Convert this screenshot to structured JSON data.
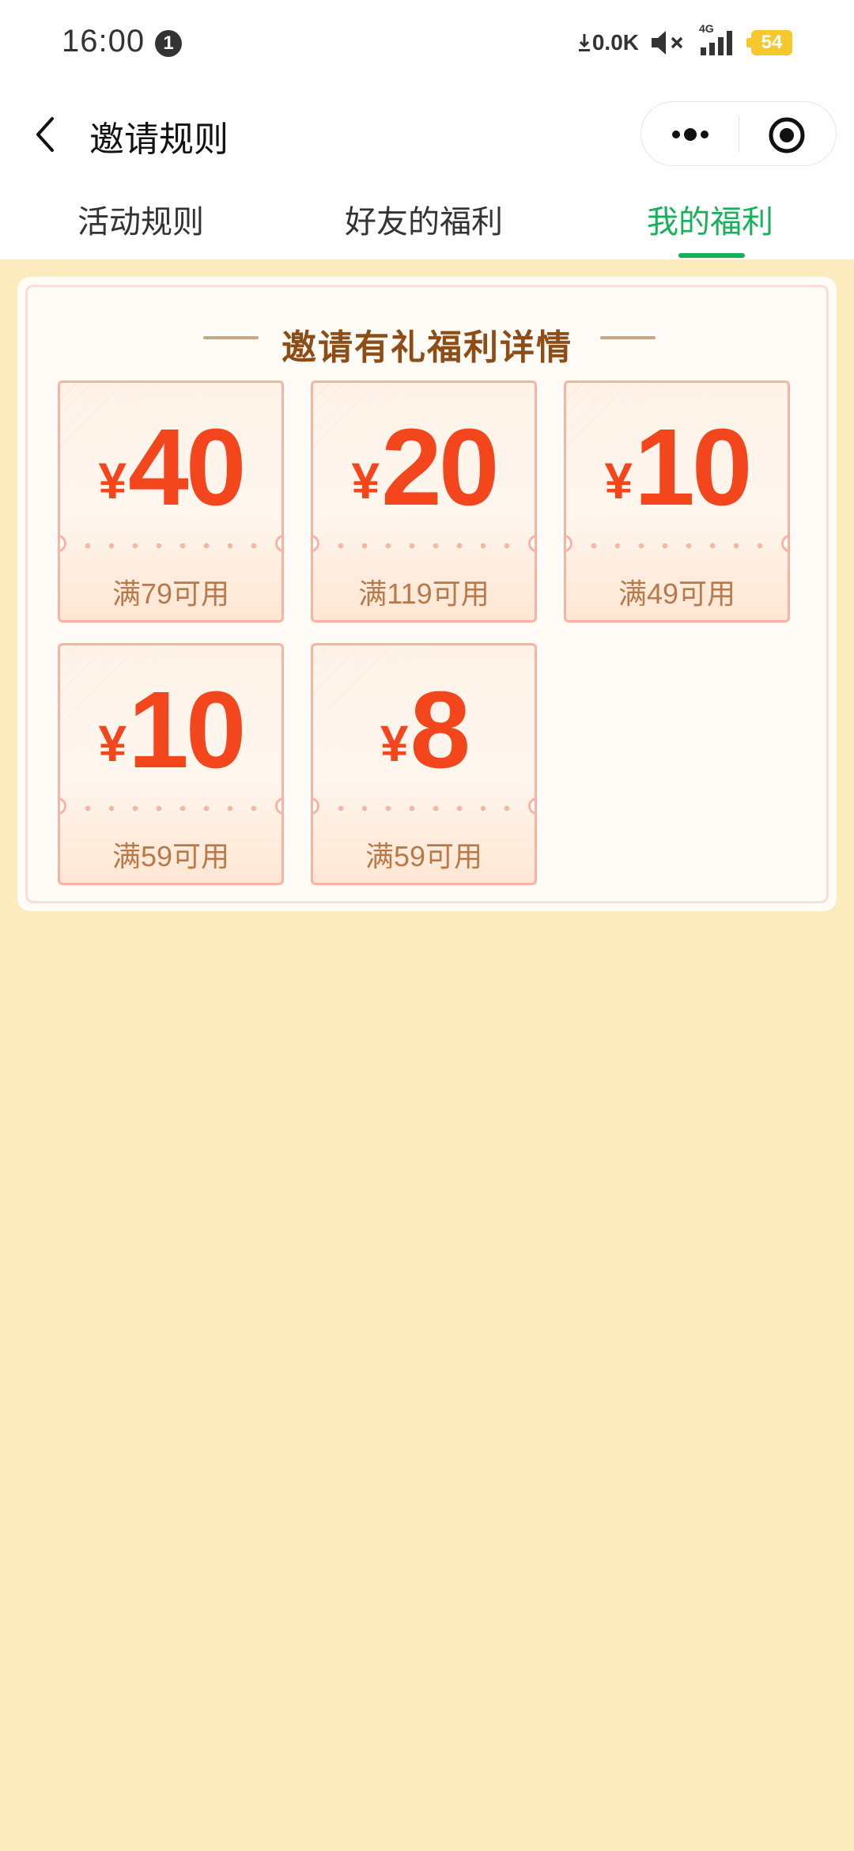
{
  "status_bar": {
    "time": "16:00",
    "notification_count": "1",
    "net_speed": "0.0K",
    "network_type": "4G",
    "battery": "54"
  },
  "nav": {
    "title": "邀请规则"
  },
  "tabs": [
    {
      "label": "活动规则",
      "active": false
    },
    {
      "label": "好友的福利",
      "active": false
    },
    {
      "label": "我的福利",
      "active": true
    }
  ],
  "panel": {
    "title": "邀请有礼福利详情",
    "coupons": [
      {
        "currency": "¥",
        "amount": "40",
        "condition": "满79可用"
      },
      {
        "currency": "¥",
        "amount": "20",
        "condition": "满119可用"
      },
      {
        "currency": "¥",
        "amount": "10",
        "condition": "满49可用"
      },
      {
        "currency": "¥",
        "amount": "10",
        "condition": "满59可用"
      },
      {
        "currency": "¥",
        "amount": "8",
        "condition": "满59可用"
      }
    ]
  },
  "colors": {
    "accent_green": "#16B159",
    "coupon_red": "#F4461C",
    "title_brown": "#8E4D17",
    "background": "#FDEBC0"
  },
  "icons": {
    "back": "chevron-left-icon",
    "more": "more-dots-icon",
    "close": "target-circle-icon",
    "mute": "mute-icon",
    "signal": "signal-icon",
    "download": "download-arrow-icon"
  }
}
